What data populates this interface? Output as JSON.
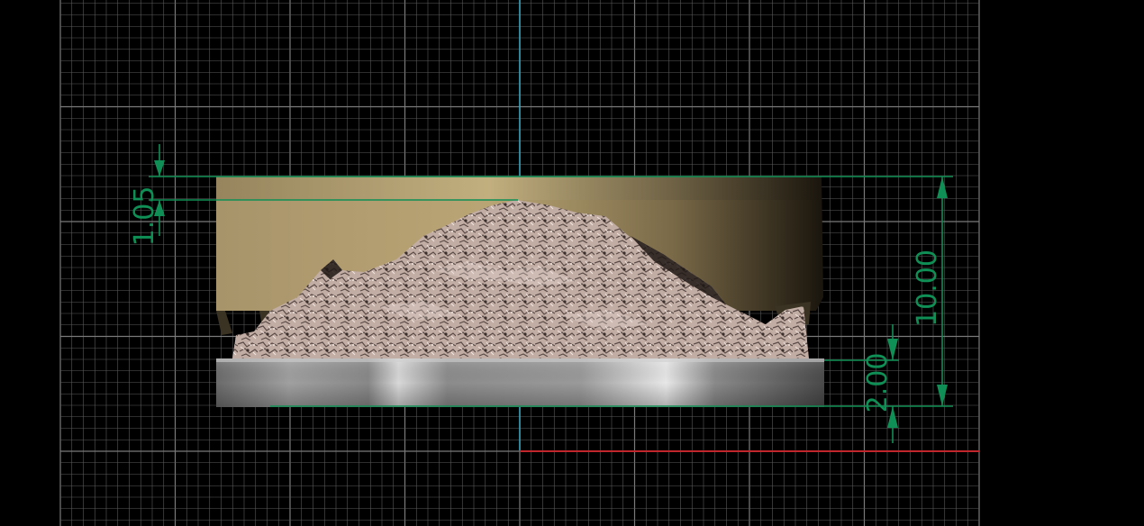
{
  "viewport": {
    "background": "#000000",
    "grid_color": "#5a5a5a",
    "grid_major_color": "#7a7a7a",
    "axis_vertical_color": "#35a9c4",
    "axis_horizontal_color": "#c0262c",
    "dimension_color": "#0f8f55"
  },
  "model": {
    "enclosure_color": "#b9a574",
    "terrain_color": "#c6b2a8",
    "base_color": "#9a9a9a"
  },
  "dimensions": {
    "top_offset": "1.05",
    "total_height": "10.00",
    "base_height": "2.00"
  }
}
